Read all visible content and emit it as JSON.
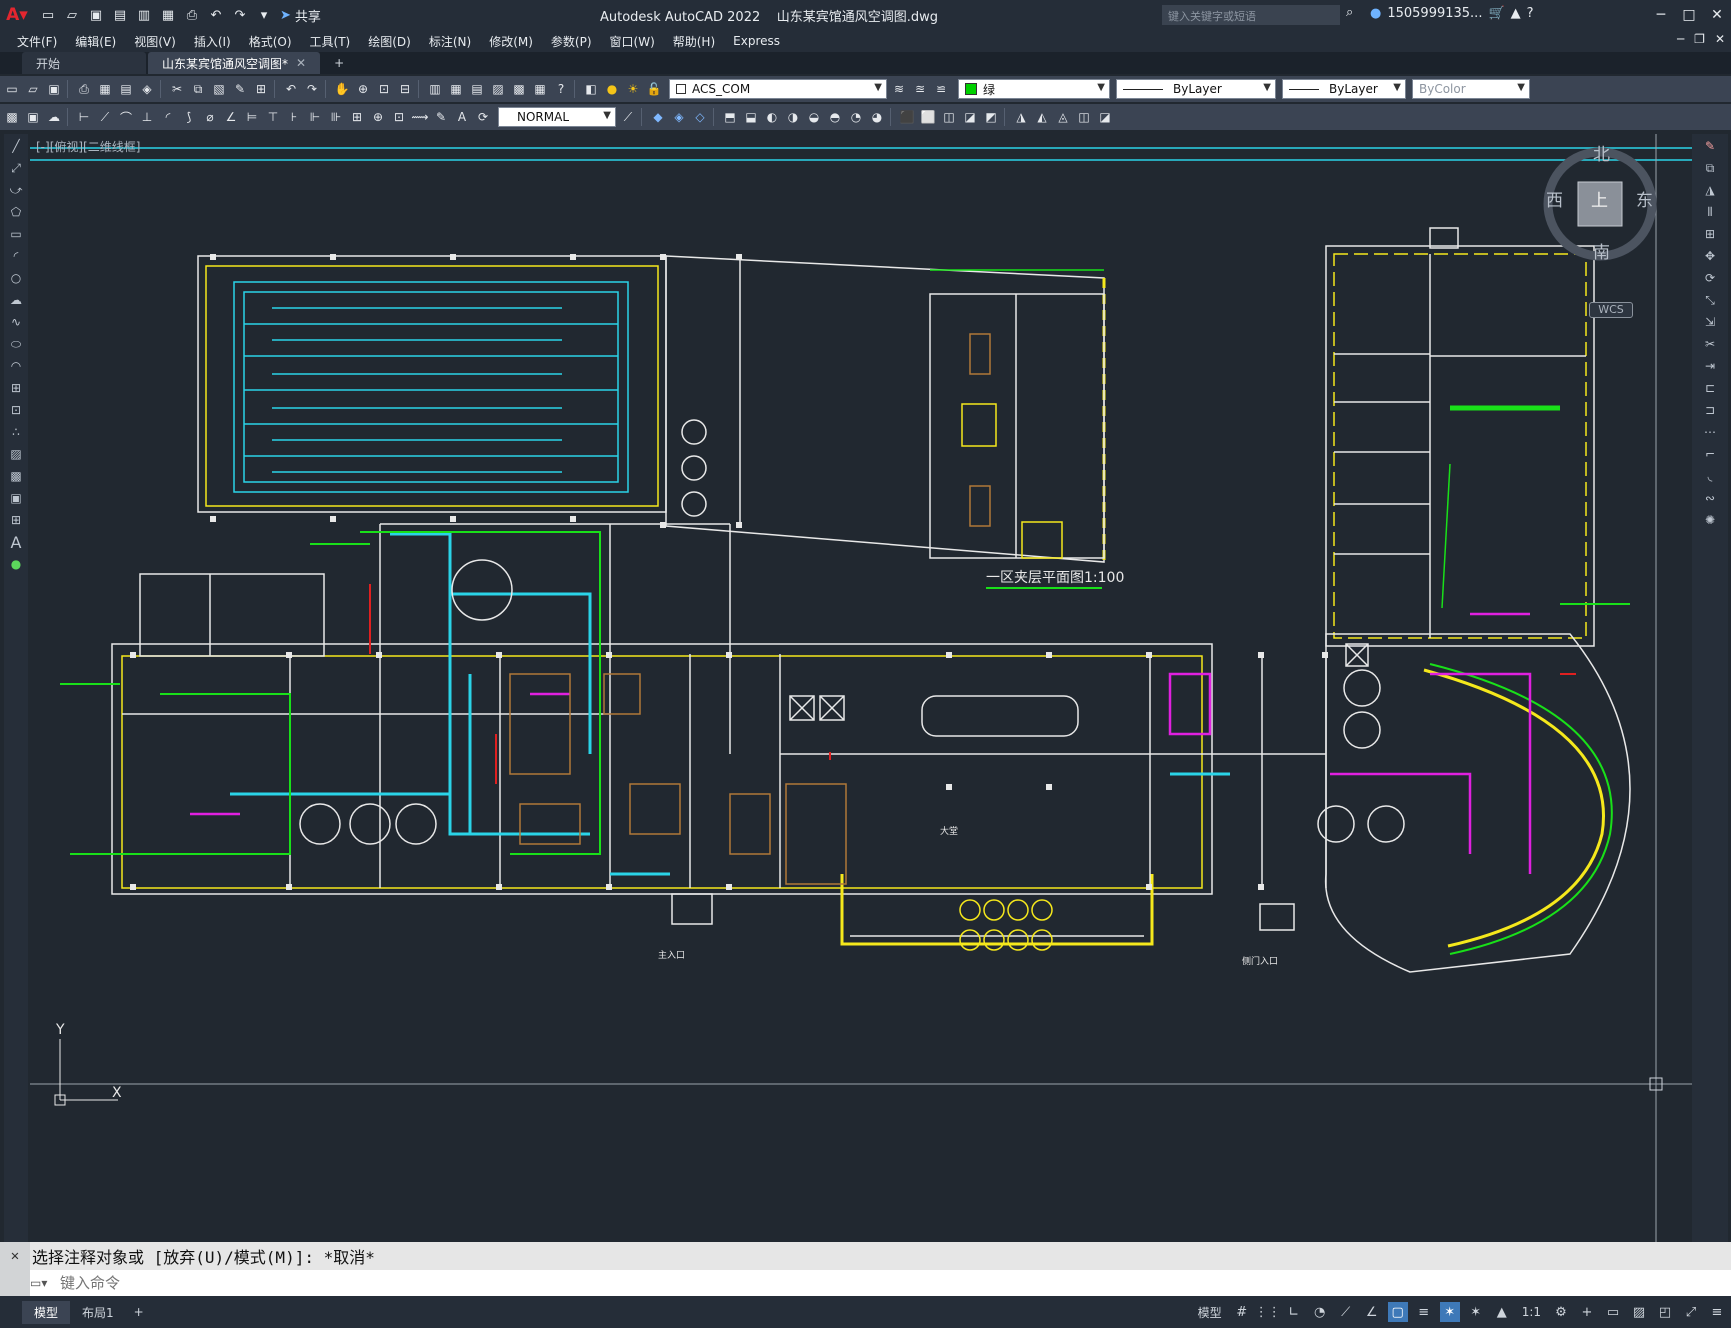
{
  "app": {
    "title": "Autodesk AutoCAD 2022    山东某宾馆通风空调图.dwg",
    "share_label": "共享",
    "search_placeholder": "键入关键字或短语",
    "user": "1505999135..."
  },
  "menu": [
    "文件(F)",
    "编辑(E)",
    "视图(V)",
    "插入(I)",
    "格式(O)",
    "工具(T)",
    "绘图(D)",
    "标注(N)",
    "修改(M)",
    "参数(P)",
    "窗口(W)",
    "帮助(H)",
    "Express"
  ],
  "tabs": {
    "start": "开始",
    "active": "山东某宾馆通风空调图*"
  },
  "toolbar": {
    "layer": "ACS_COM",
    "color": "绿",
    "linetype": "ByLayer",
    "lineweight": "ByLayer",
    "plotstyle": "ByColor",
    "style": "NORMAL"
  },
  "viewport": {
    "label": "[-][俯视][二维线框]",
    "viewcube": {
      "north": "北",
      "south": "南",
      "west": "西",
      "east": "东",
      "top": "上"
    },
    "wcs": "WCS"
  },
  "drawing": {
    "plan_title": "一区夹层平面图1:100",
    "entrance_label": "主入口",
    "entrance_label2": "侧门入口",
    "hall_label": "大堂"
  },
  "command": {
    "history": "选择注释对象或 [放弃(U)/模式(M)]: *取消*",
    "placeholder": "键入命令"
  },
  "status": {
    "tab_model": "模型",
    "tab_layout": "布局1",
    "model_label": "模型",
    "scale": "1:1"
  },
  "colors": {
    "accent_cyan": "#2ad4e8",
    "wall_white": "#e8e8e8",
    "yellow": "#f5e81c",
    "green": "#19e019",
    "magenta": "#e020e0",
    "red": "#e02020",
    "brown": "#b07838"
  }
}
